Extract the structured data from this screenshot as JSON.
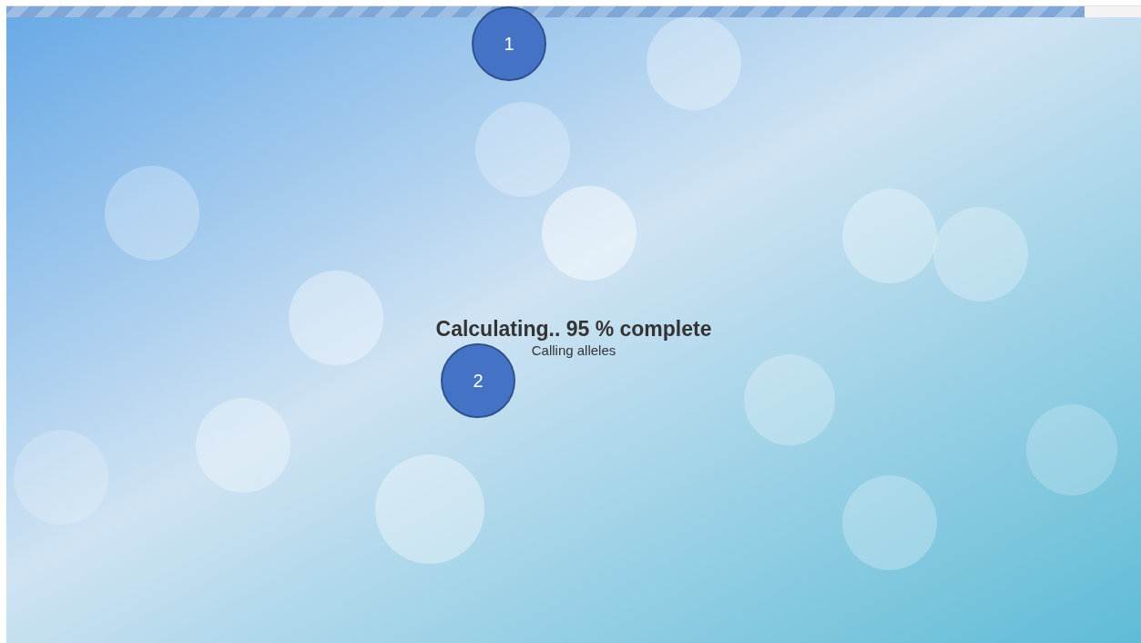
{
  "progress": {
    "level": 0.95
  },
  "status": {
    "title": "Calculating.. 95 % complete",
    "detail": "Calling alleles"
  },
  "callouts": [
    "1",
    "2"
  ]
}
